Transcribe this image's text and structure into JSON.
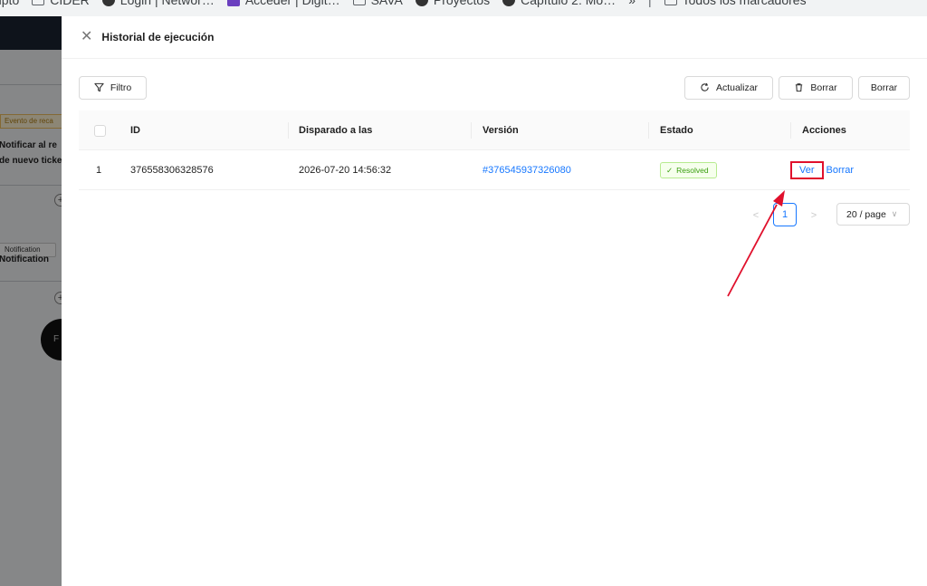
{
  "bookmarks": [
    {
      "label": "ripto",
      "icon": "none"
    },
    {
      "label": "CIDER",
      "icon": "folder-icon"
    },
    {
      "label": "Login | Networ…",
      "icon": "network-icon"
    },
    {
      "label": "Acceder | Digit…",
      "icon": "digit-logo-icon"
    },
    {
      "label": "SAVA",
      "icon": "folder-icon"
    },
    {
      "label": "Proyectos",
      "icon": "github-icon"
    },
    {
      "label": "Capítulo 2: Mo…",
      "icon": "github-icon"
    },
    {
      "label": "»",
      "icon": "none"
    },
    {
      "label": "Todos los marcadores",
      "icon": "folder-icon"
    }
  ],
  "background": {
    "event_tag": "Evento de reca",
    "text_notify_1": "Notificar al re",
    "text_notify_2": "de nuevo ticke",
    "notification_tag": "Notification",
    "notification_title": "Notification",
    "circle_text": "F"
  },
  "drawer": {
    "title": "Historial de ejecución",
    "filter_label": "Filtro",
    "refresh_label": "Actualizar",
    "delete_icon_label": "Borrar",
    "delete_label": "Borrar"
  },
  "table": {
    "columns": [
      "ID",
      "Disparado a las",
      "Versión",
      "Estado",
      "Acciones"
    ],
    "rows": [
      {
        "index": "1",
        "id": "376558306328576",
        "triggered_at": "2026-07-20 14:56:32",
        "version": "#376545937326080",
        "status": "Resolved",
        "action_view": "Ver",
        "action_delete": "Borrar"
      }
    ]
  },
  "pagination": {
    "current_page": "1",
    "page_size": "20 / page"
  },
  "colors": {
    "link": "#1677ff",
    "status_green": "#389e0d",
    "annotation_red": "#e0102c"
  }
}
